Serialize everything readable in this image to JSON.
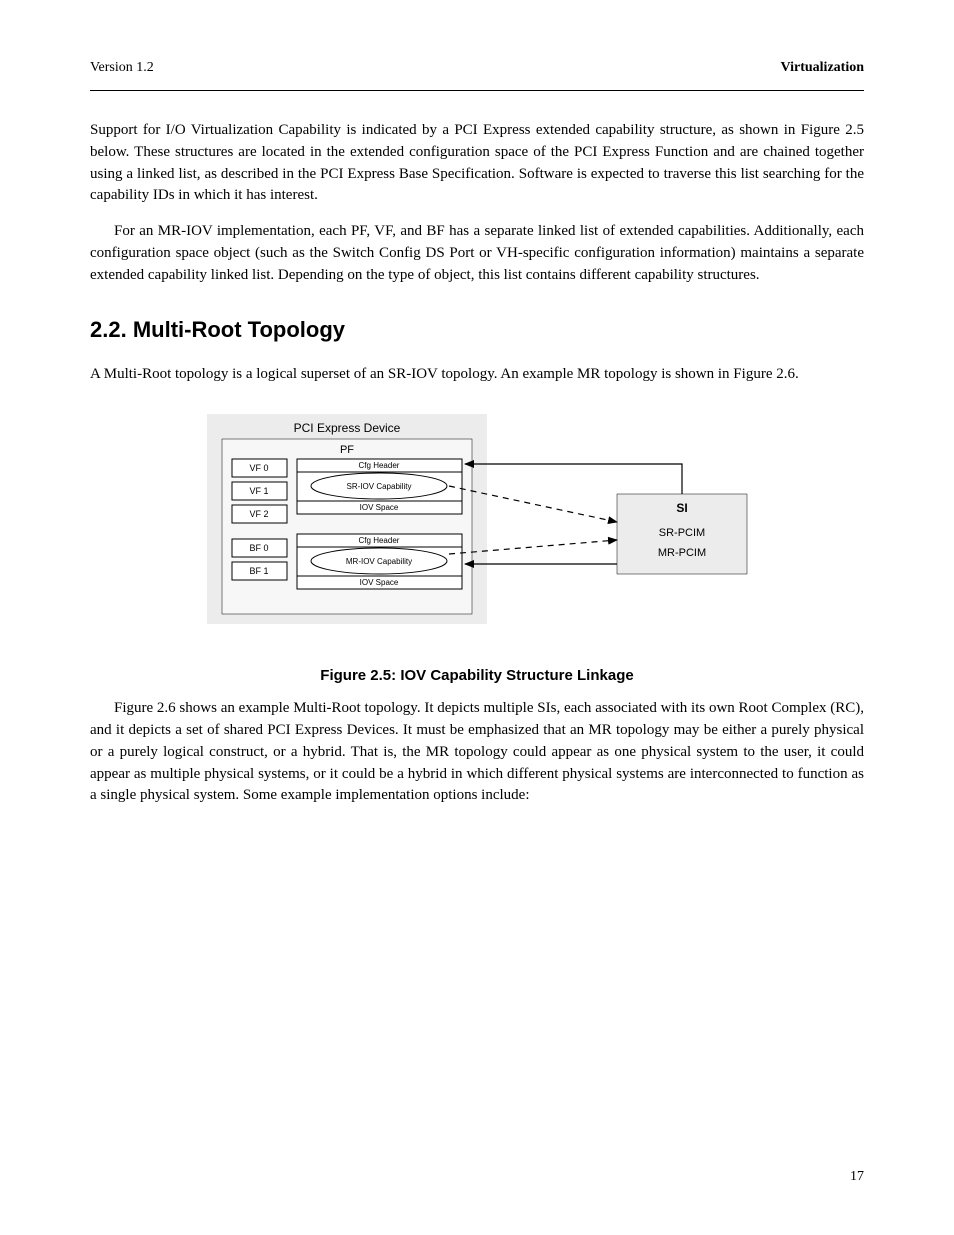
{
  "header": {
    "left": "Version 1.2",
    "right": "Virtualization"
  },
  "para1": "Support for I/O Virtualization Capability is indicated by a PCI Express extended capability structure, as shown in Figure 2.5 below. These structures are located in the extended configuration space of the PCI Express Function and are chained together using a linked list, as described in the PCI Express Base Specification. Software is expected to traverse this list searching for the capability IDs in which it has interest.",
  "para2": "For an MR-IOV implementation, each PF, VF, and BF has a separate linked list of extended capabilities. Additionally, each configuration space object (such as the Switch Config DS Port or VH-specific configuration information) maintains a separate extended capability linked list. Depending on the type of object, this list contains different capability structures.",
  "section": {
    "number": "2.2.",
    "title": "Multi-Root Topology"
  },
  "para3": "A Multi-Root topology is a logical superset of an SR-IOV topology. An example MR topology is shown in Figure 2.6.",
  "figure": {
    "caption": "Figure 2.5: IOV Capability Structure Linkage",
    "pcie_title": "PCI Express Device",
    "pf_title": "PF",
    "sriov_label": "SR-IOV Capability",
    "mriov_label": "MR-IOV Capability",
    "cfg_header": "Cfg Header",
    "iov_space": "IOV Space",
    "vf0": "VF 0",
    "vf1": "VF 1",
    "vf2": "VF 2",
    "bf0": "BF 0",
    "bf1": "BF 1",
    "si_title": "SI",
    "sr_pcim": "SR-PCIM",
    "mr_pcim": "MR-PCIM"
  },
  "para4": "Figure 2.6 shows an example Multi-Root topology. It depicts multiple SIs, each associated with its own Root Complex (RC), and it depicts a set of shared PCI Express Devices. It must be emphasized that an MR topology may be either a purely physical or a purely logical construct, or a hybrid. That is, the MR topology could appear as one physical system to the user, it could appear as multiple physical systems, or it could be a hybrid in which different physical systems are interconnected to function as a single physical system. Some example implementation options include:",
  "page_number": "17"
}
